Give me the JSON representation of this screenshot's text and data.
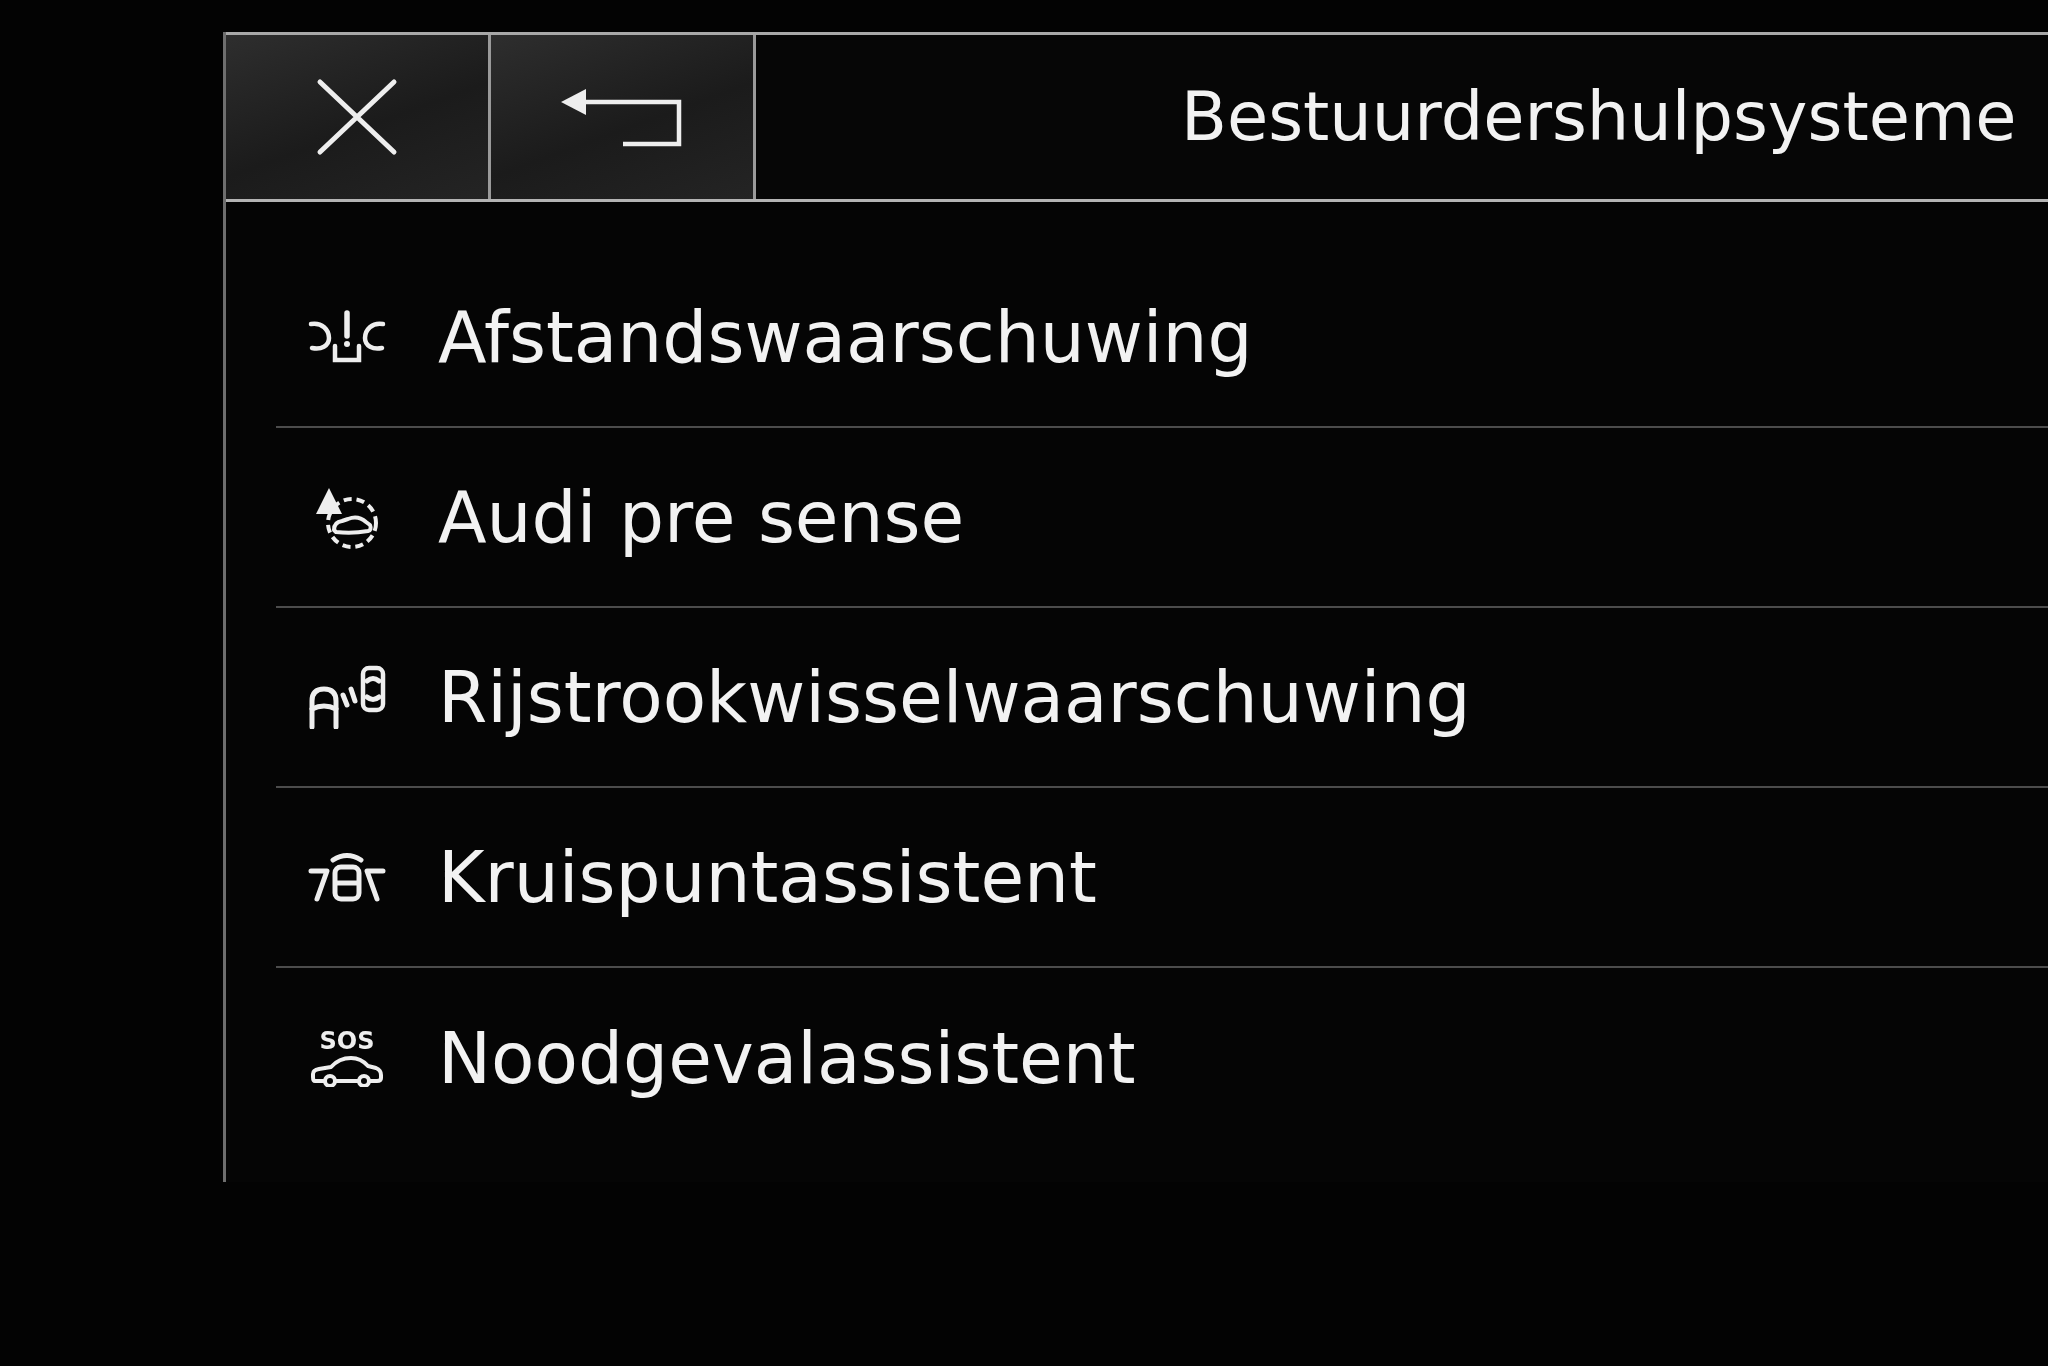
{
  "header": {
    "title": "Bestuurdershulpsysteme"
  },
  "menu_items": [
    {
      "label": "Afstandswaarschuwing"
    },
    {
      "label": "Audi pre sense"
    },
    {
      "label": "Rijstrookwisselwaarschuwing"
    },
    {
      "label": "Kruispuntassistent"
    },
    {
      "label": "Noodgevalassistent",
      "icon_label": "SOS"
    }
  ]
}
